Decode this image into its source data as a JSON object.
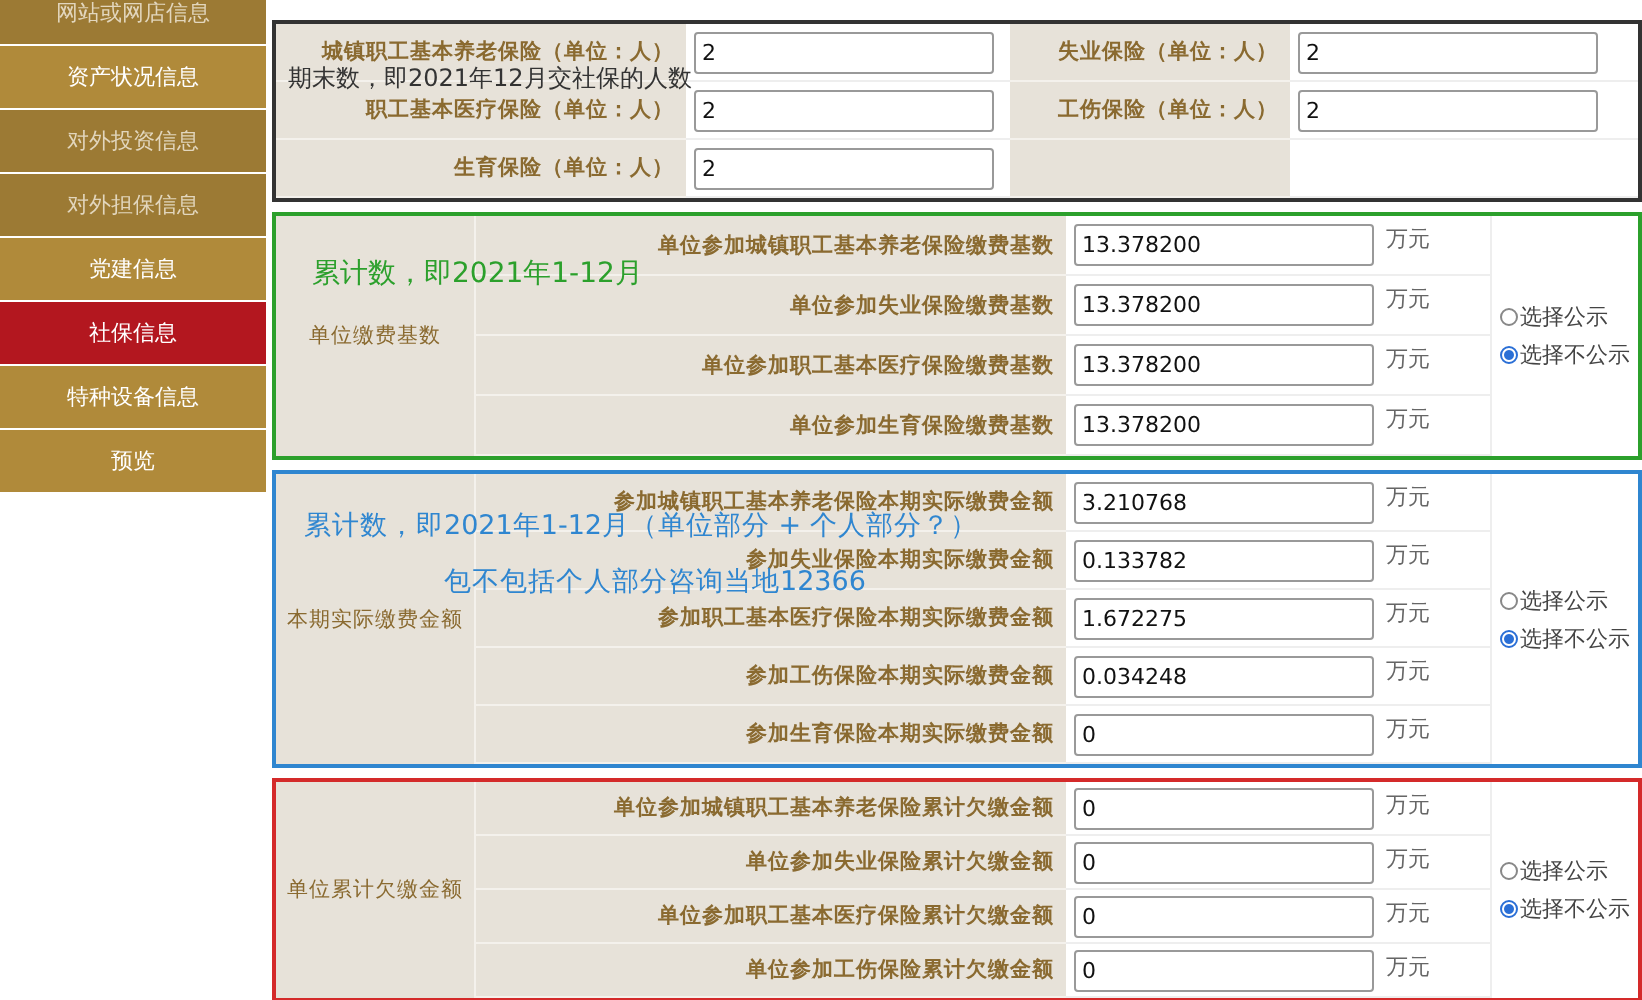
{
  "sidebar": {
    "items": [
      {
        "label": "网站或网店信息",
        "selected": false,
        "disabled": true
      },
      {
        "label": "资产状况信息",
        "selected": false,
        "disabled": false
      },
      {
        "label": "对外投资信息",
        "selected": false,
        "disabled": true
      },
      {
        "label": "对外担保信息",
        "selected": false,
        "disabled": true
      },
      {
        "label": "党建信息",
        "selected": false,
        "disabled": false
      },
      {
        "label": "社保信息",
        "selected": true,
        "disabled": false
      },
      {
        "label": "特种设备信息",
        "selected": false,
        "disabled": false
      },
      {
        "label": "预览",
        "selected": false,
        "disabled": false
      }
    ]
  },
  "sections": [
    {
      "kind": "headcount",
      "color": "#333333",
      "notes": [
        "期末数，即2021年12月交社保的人数"
      ],
      "fields": [
        {
          "label": "城镇职工基本养老保险（单位：人）",
          "value": "2"
        },
        {
          "label": "失业保险（单位：人）",
          "value": "2"
        },
        {
          "label": "职工基本医疗保险（单位：人）",
          "value": "2"
        },
        {
          "label": "工伤保险（单位：人）",
          "value": "2"
        },
        {
          "label": "生育保险（单位：人）",
          "value": "2"
        }
      ]
    },
    {
      "kind": "amounts",
      "color": "#2ca02c",
      "group_label": "单位缴费基数",
      "notes": [
        "累计数，即2021年1-12月"
      ],
      "rows": [
        {
          "label": "单位参加城镇职工基本养老保险缴费基数",
          "value": "13.378200",
          "unit": "万元"
        },
        {
          "label": "单位参加失业保险缴费基数",
          "value": "13.378200",
          "unit": "万元"
        },
        {
          "label": "单位参加职工基本医疗保险缴费基数",
          "value": "13.378200",
          "unit": "万元"
        },
        {
          "label": "单位参加生育保险缴费基数",
          "value": "13.378200",
          "unit": "万元"
        }
      ],
      "options": [
        {
          "label": "选择公示",
          "selected": false
        },
        {
          "label": "选择不公示",
          "selected": true
        }
      ]
    },
    {
      "kind": "amounts",
      "color": "#2f86d0",
      "group_label": "本期实际缴费金额",
      "notes": [
        "累计数，即2021年1-12月（单位部分 + 个人部分？）",
        "包不包括个人部分咨询当地12366"
      ],
      "rows": [
        {
          "label": "参加城镇职工基本养老保险本期实际缴费金额",
          "value": "3.210768",
          "unit": "万元"
        },
        {
          "label": "参加失业保险本期实际缴费金额",
          "value": "0.133782",
          "unit": "万元"
        },
        {
          "label": "参加职工基本医疗保险本期实际缴费金额",
          "value": "1.672275",
          "unit": "万元"
        },
        {
          "label": "参加工伤保险本期实际缴费金额",
          "value": "0.034248",
          "unit": "万元"
        },
        {
          "label": "参加生育保险本期实际缴费金额",
          "value": "0",
          "unit": "万元"
        }
      ],
      "options": [
        {
          "label": "选择公示",
          "selected": false
        },
        {
          "label": "选择不公示",
          "selected": true
        }
      ]
    },
    {
      "kind": "amounts",
      "color": "#d42a2a",
      "group_label": "单位累计欠缴金额",
      "rows": [
        {
          "label": "单位参加城镇职工基本养老保险累计欠缴金额",
          "value": "0",
          "unit": "万元"
        },
        {
          "label": "单位参加失业保险累计欠缴金额",
          "value": "0",
          "unit": "万元"
        },
        {
          "label": "单位参加职工基本医疗保险累计欠缴金额",
          "value": "0",
          "unit": "万元"
        },
        {
          "label": "单位参加工伤保险累计欠缴金额",
          "value": "0",
          "unit": "万元"
        }
      ],
      "options": [
        {
          "label": "选择公示",
          "selected": false
        },
        {
          "label": "选择不公示",
          "selected": true
        }
      ]
    }
  ]
}
